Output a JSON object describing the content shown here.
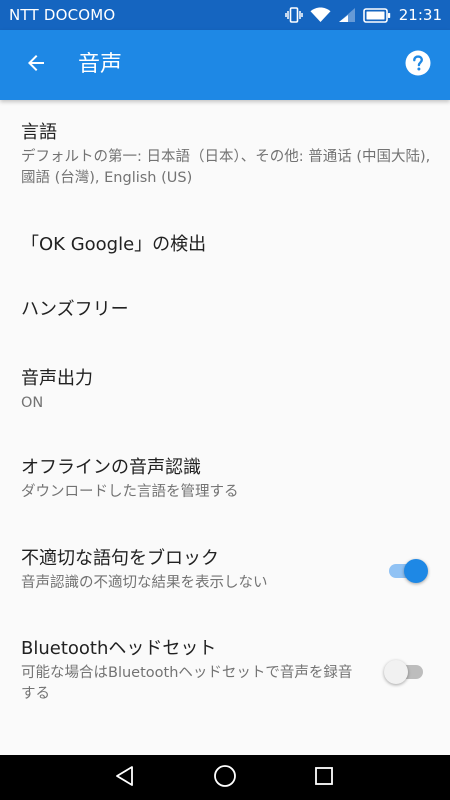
{
  "status_bar": {
    "carrier": "NTT DOCOMO",
    "time": "21:31",
    "icons": [
      "vibrate-icon",
      "wifi-icon",
      "signal-icon",
      "battery-icon"
    ]
  },
  "app_bar": {
    "title": "音声",
    "back_icon": "arrow-left-icon",
    "help_icon": "help-circle-icon",
    "color": "#1e88e5"
  },
  "settings": [
    {
      "title": "言語",
      "subtitle": "デフォルトの第一: 日本語（日本）、その他: 普通话 (中国大陆), 國語 (台灣), English (US)"
    },
    {
      "title": "「OK Google」の検出"
    },
    {
      "title": "ハンズフリー"
    },
    {
      "title": "音声出力",
      "subtitle": "ON"
    },
    {
      "title": "オフラインの音声認識",
      "subtitle": "ダウンロードした言語を管理する"
    },
    {
      "title": "不適切な語句をブロック",
      "subtitle": "音声認識の不適切な結果を表示しない",
      "toggle": "on"
    },
    {
      "title": "Bluetoothヘッドセット",
      "subtitle": "可能な場合はBluetoothヘッドセットで音声を録音する",
      "toggle": "off"
    }
  ],
  "nav_bar": {
    "icons": [
      "back-triangle-icon",
      "home-circle-icon",
      "recents-square-icon"
    ]
  },
  "colors": {
    "status_bar": "#1565c0",
    "accent": "#1e88e5",
    "background": "#fafafa"
  }
}
